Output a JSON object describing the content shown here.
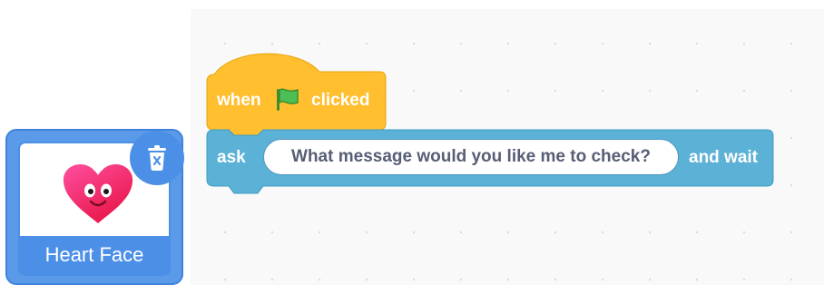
{
  "sprite": {
    "name": "Heart Face",
    "tile_color": "#4c8fe6",
    "icons": {
      "costume": "heart-face-icon",
      "delete": "trash-icon"
    }
  },
  "script": {
    "hat_block": {
      "when_label": "when",
      "flag_icon": "green-flag-icon",
      "clicked_label": "clicked",
      "color": "#ffbf2e"
    },
    "ask_block": {
      "ask_label": "ask",
      "question": "What message would you like me to check?",
      "and_wait_label": "and wait",
      "color": "#5cb1d6"
    }
  }
}
